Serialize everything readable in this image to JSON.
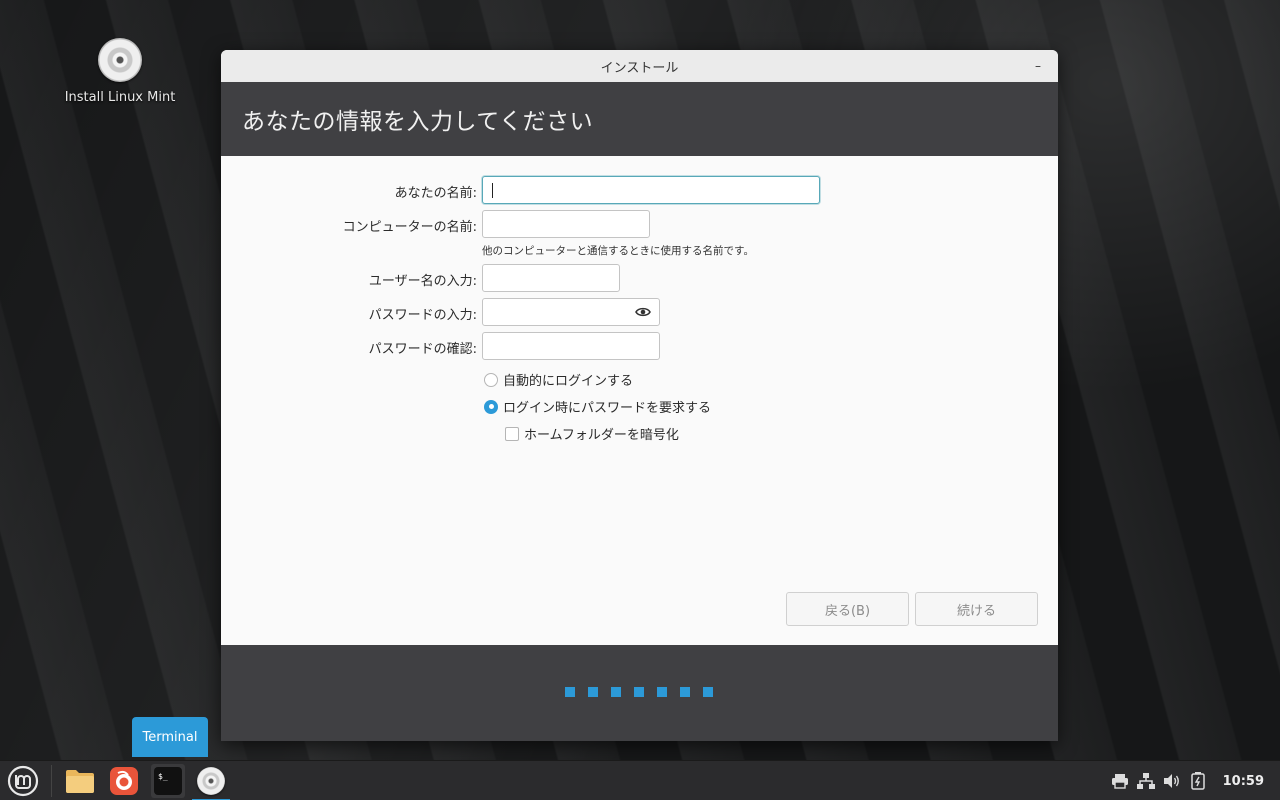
{
  "desktop": {
    "icon_label": "Install Linux Mint"
  },
  "window": {
    "title": "インストール",
    "minimize_symbol": "–",
    "header_title": "あなたの情報を入力してください"
  },
  "form": {
    "name_label": "あなたの名前:",
    "name_value": "",
    "computer_label": "コンピューターの名前:",
    "computer_value": "",
    "computer_hint": "他のコンピューターと通信するときに使用する名前です。",
    "username_label": "ユーザー名の入力:",
    "username_value": "",
    "password_label": "パスワードの入力:",
    "password_value": "",
    "confirm_label": "パスワードの確認:",
    "confirm_value": "",
    "auto_login_label": "自動的にログインする",
    "require_password_label": "ログイン時にパスワードを要求する",
    "encrypt_home_label": "ホームフォルダーを暗号化",
    "selected_login_option": "require_password",
    "encrypt_home_checked": false
  },
  "buttons": {
    "back_label": "戻る(B)",
    "continue_label": "続ける"
  },
  "progress": {
    "step_count": 7,
    "accent_color": "#2c9ad8"
  },
  "tooltip": {
    "text": "Terminal"
  },
  "taskbar": {
    "items": [
      "menu-icon",
      "files-icon",
      "firefox-icon",
      "terminal-icon",
      "installer-icon"
    ],
    "tray": [
      "printer-icon",
      "network-icon",
      "volume-icon",
      "battery-icon"
    ],
    "clock": "10:59"
  }
}
